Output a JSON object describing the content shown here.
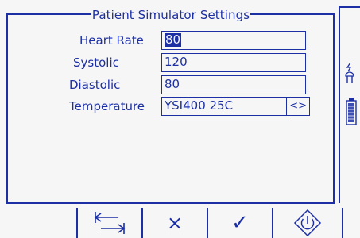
{
  "panel": {
    "title": "Patient Simulator Settings"
  },
  "fields": [
    {
      "label": "Heart Rate",
      "value": "80",
      "focused": true
    },
    {
      "label": "Systolic",
      "value": "120"
    },
    {
      "label": "Diastolic",
      "value": "80"
    },
    {
      "label": "Temperature",
      "value": "YSI400 25C",
      "cycle_label": "<>"
    }
  ],
  "side_icons": [
    "power-plug-icon",
    "battery-icon"
  ],
  "toolbar": {
    "buttons": [
      {
        "name": "swap-arrows-button",
        "icon": "swap-arrows-icon"
      },
      {
        "name": "cancel-button",
        "icon": "cross-icon",
        "glyph": "×"
      },
      {
        "name": "confirm-button",
        "icon": "checkmark-icon",
        "glyph": "✓"
      },
      {
        "name": "power-button",
        "icon": "power-icon"
      }
    ]
  },
  "colors": {
    "foreground": "#1c2fa4",
    "background": "#f6f6f7"
  }
}
